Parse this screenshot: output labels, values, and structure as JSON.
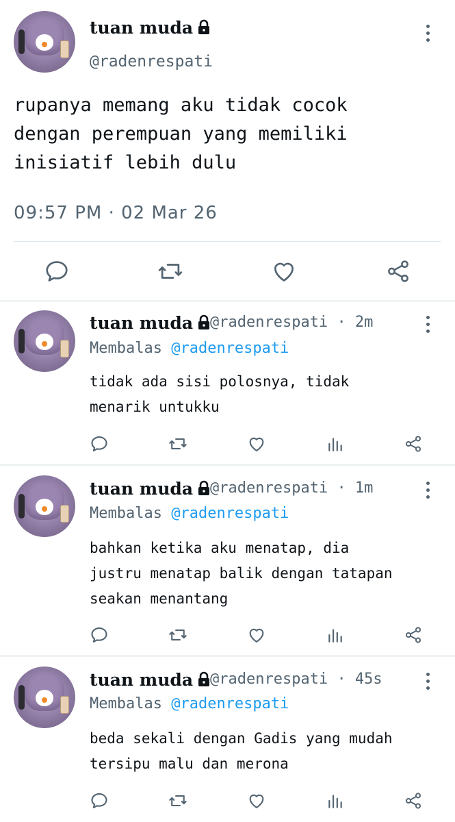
{
  "main_tweet": {
    "display_name": "tuan muda",
    "handle": "@radenrespati",
    "text_lines": [
      "rupanya memang aku tidak cocok",
      "dengan perempuan yang memiliki",
      "inisiatif lebih dulu"
    ],
    "timestamp": "09:57 PM · 02 Mar 26"
  },
  "replies": [
    {
      "display_name": "tuan muda",
      "handle": "@radenrespati",
      "time": "· 2m",
      "reply_prefix": "Membalas",
      "reply_to": "@radenrespati",
      "text_lines": [
        "tidak ada sisi polosnya, tidak",
        "menarik untukku"
      ]
    },
    {
      "display_name": "tuan muda",
      "handle": "@radenrespati",
      "time": "· 1m",
      "reply_prefix": "Membalas",
      "reply_to": "@radenrespati",
      "text_lines": [
        "bahkan ketika aku menatap, dia",
        "justru menatap balik dengan tatapan",
        "seakan menantang"
      ]
    },
    {
      "display_name": "tuan muda",
      "handle": "@radenrespati",
      "time": "· 45s",
      "reply_prefix": "Membalas",
      "reply_to": "@radenrespati",
      "text_lines": [
        "beda sekali dengan Gadis yang mudah",
        "tersipu malu dan merona"
      ]
    }
  ],
  "colors": {
    "text": "#0f1419",
    "muted": "#536471",
    "link": "#1d9bf0",
    "divider": "#eff3f4"
  },
  "icons": [
    "lock-icon",
    "more-icon",
    "reply-icon",
    "retweet-icon",
    "like-icon",
    "views-icon",
    "share-icon"
  ]
}
